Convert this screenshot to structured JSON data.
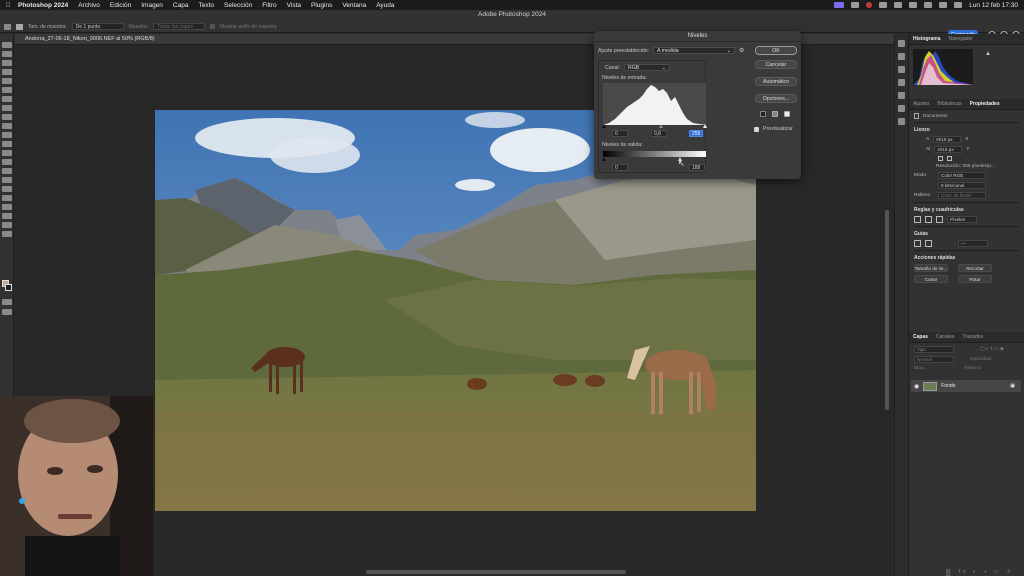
{
  "menubar": {
    "app_name": "Photoshop 2024",
    "items": [
      "Archivo",
      "Edición",
      "Imagen",
      "Capa",
      "Texto",
      "Selección",
      "Filtro",
      "Vista",
      "Plugins",
      "Ventana",
      "Ayuda"
    ],
    "datetime": "Lun 12 feb 17:30"
  },
  "options": {
    "window_title": "Adobe Photoshop 2024",
    "sample_size_label": "Tam. de muestra:",
    "sample_size_value": "De 1 punto",
    "sample_label": "Muestra:",
    "sample_value": "Todas las capas",
    "show_ring": "Mostrar anillo de muestra",
    "share_button": "Compartir"
  },
  "document": {
    "tab_title": "Andorra_27-06-18_Nikon_0006.NEF al 50% (RGB/8)"
  },
  "dialog": {
    "title": "Niveles",
    "preset_label": "Ajuste preestablecido:",
    "preset_value": "A medida",
    "channel_label": "Canal:",
    "channel_value": "RGB",
    "input_label": "Niveles de entrada:",
    "input_black": "0",
    "input_mid": "0,8",
    "input_white": "255",
    "output_label": "Niveles de salida:",
    "output_black": "0",
    "output_white": "188",
    "buttons": {
      "ok": "OK",
      "cancel": "Cancelar",
      "auto": "Automático",
      "options": "Opciones..."
    },
    "preview_label": "Previsualizar",
    "preview_checked": true
  },
  "panels": {
    "top_tabs": [
      "Histograma",
      "Navegador"
    ],
    "mid_tabs": [
      "Ajustes",
      "Bibliotecas",
      "Propiedades"
    ],
    "document_label": "Documento",
    "canvas_title": "Lienzo",
    "width_label": "A",
    "width_value": "6016 px",
    "height_label": "Al",
    "height_value": "4016 px",
    "resolution": "Resolución: 300 píxeles/p...",
    "mode_label": "Modo",
    "mode_value": "Color RGB",
    "bits_value": "8 bits/canal",
    "fill_label": "Relleno",
    "fill_value": "Color de fondo",
    "rulers_title": "Reglas y cuadrículas",
    "rulers_unit": "Píxeles",
    "guides_title": "Guías",
    "quick_actions_title": "Acciones rápidas",
    "quick_actions": [
      "Tamaño de im...",
      "Recortar",
      "Cortar",
      "Rotar"
    ],
    "layer_tabs": [
      "Capas",
      "Canales",
      "Trazados"
    ],
    "search_placeholder": "Tipo",
    "blend_mode": "Normal",
    "opacity_label": "Opacidad:",
    "lock_label": "Bloq.:",
    "fill_layer_label": "Relleno:",
    "layer_name": "Fondo"
  }
}
